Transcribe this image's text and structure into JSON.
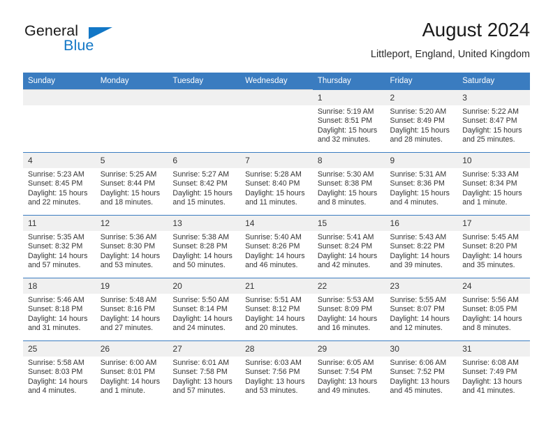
{
  "brand": {
    "name_part1": "General",
    "name_part2": "Blue",
    "triangle_icon": "triangle-icon",
    "accent_color": "#1277c6"
  },
  "header": {
    "title": "August 2024",
    "subtitle": "Littleport, England, United Kingdom"
  },
  "calendar": {
    "header_bg": "#3a7cc0",
    "weekday_headers": [
      "Sunday",
      "Monday",
      "Tuesday",
      "Wednesday",
      "Thursday",
      "Friday",
      "Saturday"
    ],
    "weeks": [
      [
        {
          "day": "",
          "sunrise": "",
          "sunset": "",
          "daylight1": "",
          "daylight2": ""
        },
        {
          "day": "",
          "sunrise": "",
          "sunset": "",
          "daylight1": "",
          "daylight2": ""
        },
        {
          "day": "",
          "sunrise": "",
          "sunset": "",
          "daylight1": "",
          "daylight2": ""
        },
        {
          "day": "",
          "sunrise": "",
          "sunset": "",
          "daylight1": "",
          "daylight2": ""
        },
        {
          "day": "1",
          "sunrise": "Sunrise: 5:19 AM",
          "sunset": "Sunset: 8:51 PM",
          "daylight1": "Daylight: 15 hours",
          "daylight2": "and 32 minutes."
        },
        {
          "day": "2",
          "sunrise": "Sunrise: 5:20 AM",
          "sunset": "Sunset: 8:49 PM",
          "daylight1": "Daylight: 15 hours",
          "daylight2": "and 28 minutes."
        },
        {
          "day": "3",
          "sunrise": "Sunrise: 5:22 AM",
          "sunset": "Sunset: 8:47 PM",
          "daylight1": "Daylight: 15 hours",
          "daylight2": "and 25 minutes."
        }
      ],
      [
        {
          "day": "4",
          "sunrise": "Sunrise: 5:23 AM",
          "sunset": "Sunset: 8:45 PM",
          "daylight1": "Daylight: 15 hours",
          "daylight2": "and 22 minutes."
        },
        {
          "day": "5",
          "sunrise": "Sunrise: 5:25 AM",
          "sunset": "Sunset: 8:44 PM",
          "daylight1": "Daylight: 15 hours",
          "daylight2": "and 18 minutes."
        },
        {
          "day": "6",
          "sunrise": "Sunrise: 5:27 AM",
          "sunset": "Sunset: 8:42 PM",
          "daylight1": "Daylight: 15 hours",
          "daylight2": "and 15 minutes."
        },
        {
          "day": "7",
          "sunrise": "Sunrise: 5:28 AM",
          "sunset": "Sunset: 8:40 PM",
          "daylight1": "Daylight: 15 hours",
          "daylight2": "and 11 minutes."
        },
        {
          "day": "8",
          "sunrise": "Sunrise: 5:30 AM",
          "sunset": "Sunset: 8:38 PM",
          "daylight1": "Daylight: 15 hours",
          "daylight2": "and 8 minutes."
        },
        {
          "day": "9",
          "sunrise": "Sunrise: 5:31 AM",
          "sunset": "Sunset: 8:36 PM",
          "daylight1": "Daylight: 15 hours",
          "daylight2": "and 4 minutes."
        },
        {
          "day": "10",
          "sunrise": "Sunrise: 5:33 AM",
          "sunset": "Sunset: 8:34 PM",
          "daylight1": "Daylight: 15 hours",
          "daylight2": "and 1 minute."
        }
      ],
      [
        {
          "day": "11",
          "sunrise": "Sunrise: 5:35 AM",
          "sunset": "Sunset: 8:32 PM",
          "daylight1": "Daylight: 14 hours",
          "daylight2": "and 57 minutes."
        },
        {
          "day": "12",
          "sunrise": "Sunrise: 5:36 AM",
          "sunset": "Sunset: 8:30 PM",
          "daylight1": "Daylight: 14 hours",
          "daylight2": "and 53 minutes."
        },
        {
          "day": "13",
          "sunrise": "Sunrise: 5:38 AM",
          "sunset": "Sunset: 8:28 PM",
          "daylight1": "Daylight: 14 hours",
          "daylight2": "and 50 minutes."
        },
        {
          "day": "14",
          "sunrise": "Sunrise: 5:40 AM",
          "sunset": "Sunset: 8:26 PM",
          "daylight1": "Daylight: 14 hours",
          "daylight2": "and 46 minutes."
        },
        {
          "day": "15",
          "sunrise": "Sunrise: 5:41 AM",
          "sunset": "Sunset: 8:24 PM",
          "daylight1": "Daylight: 14 hours",
          "daylight2": "and 42 minutes."
        },
        {
          "day": "16",
          "sunrise": "Sunrise: 5:43 AM",
          "sunset": "Sunset: 8:22 PM",
          "daylight1": "Daylight: 14 hours",
          "daylight2": "and 39 minutes."
        },
        {
          "day": "17",
          "sunrise": "Sunrise: 5:45 AM",
          "sunset": "Sunset: 8:20 PM",
          "daylight1": "Daylight: 14 hours",
          "daylight2": "and 35 minutes."
        }
      ],
      [
        {
          "day": "18",
          "sunrise": "Sunrise: 5:46 AM",
          "sunset": "Sunset: 8:18 PM",
          "daylight1": "Daylight: 14 hours",
          "daylight2": "and 31 minutes."
        },
        {
          "day": "19",
          "sunrise": "Sunrise: 5:48 AM",
          "sunset": "Sunset: 8:16 PM",
          "daylight1": "Daylight: 14 hours",
          "daylight2": "and 27 minutes."
        },
        {
          "day": "20",
          "sunrise": "Sunrise: 5:50 AM",
          "sunset": "Sunset: 8:14 PM",
          "daylight1": "Daylight: 14 hours",
          "daylight2": "and 24 minutes."
        },
        {
          "day": "21",
          "sunrise": "Sunrise: 5:51 AM",
          "sunset": "Sunset: 8:12 PM",
          "daylight1": "Daylight: 14 hours",
          "daylight2": "and 20 minutes."
        },
        {
          "day": "22",
          "sunrise": "Sunrise: 5:53 AM",
          "sunset": "Sunset: 8:09 PM",
          "daylight1": "Daylight: 14 hours",
          "daylight2": "and 16 minutes."
        },
        {
          "day": "23",
          "sunrise": "Sunrise: 5:55 AM",
          "sunset": "Sunset: 8:07 PM",
          "daylight1": "Daylight: 14 hours",
          "daylight2": "and 12 minutes."
        },
        {
          "day": "24",
          "sunrise": "Sunrise: 5:56 AM",
          "sunset": "Sunset: 8:05 PM",
          "daylight1": "Daylight: 14 hours",
          "daylight2": "and 8 minutes."
        }
      ],
      [
        {
          "day": "25",
          "sunrise": "Sunrise: 5:58 AM",
          "sunset": "Sunset: 8:03 PM",
          "daylight1": "Daylight: 14 hours",
          "daylight2": "and 4 minutes."
        },
        {
          "day": "26",
          "sunrise": "Sunrise: 6:00 AM",
          "sunset": "Sunset: 8:01 PM",
          "daylight1": "Daylight: 14 hours",
          "daylight2": "and 1 minute."
        },
        {
          "day": "27",
          "sunrise": "Sunrise: 6:01 AM",
          "sunset": "Sunset: 7:58 PM",
          "daylight1": "Daylight: 13 hours",
          "daylight2": "and 57 minutes."
        },
        {
          "day": "28",
          "sunrise": "Sunrise: 6:03 AM",
          "sunset": "Sunset: 7:56 PM",
          "daylight1": "Daylight: 13 hours",
          "daylight2": "and 53 minutes."
        },
        {
          "day": "29",
          "sunrise": "Sunrise: 6:05 AM",
          "sunset": "Sunset: 7:54 PM",
          "daylight1": "Daylight: 13 hours",
          "daylight2": "and 49 minutes."
        },
        {
          "day": "30",
          "sunrise": "Sunrise: 6:06 AM",
          "sunset": "Sunset: 7:52 PM",
          "daylight1": "Daylight: 13 hours",
          "daylight2": "and 45 minutes."
        },
        {
          "day": "31",
          "sunrise": "Sunrise: 6:08 AM",
          "sunset": "Sunset: 7:49 PM",
          "daylight1": "Daylight: 13 hours",
          "daylight2": "and 41 minutes."
        }
      ]
    ]
  }
}
